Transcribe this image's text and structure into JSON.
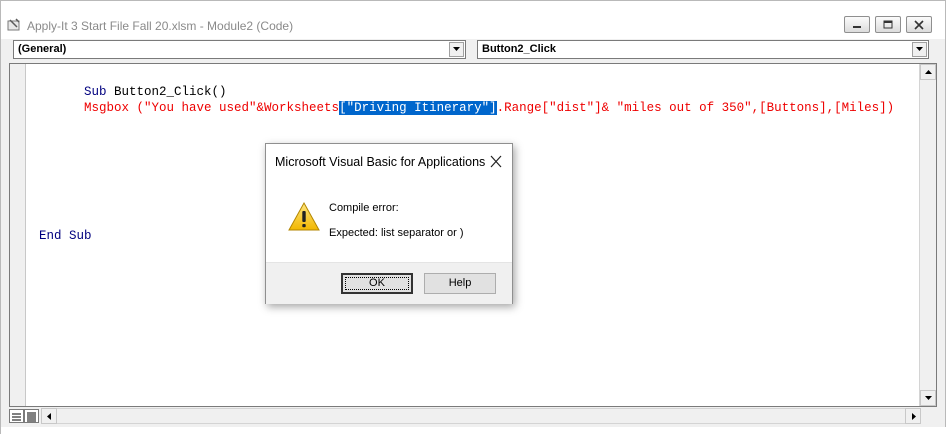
{
  "window": {
    "title": "Apply-It 3 Start File Fall 20.xlsm - Module2 (Code)"
  },
  "toolbar": {
    "object_combo": "(General)",
    "procedure_combo": "Button2_Click"
  },
  "code": {
    "line1_kw": "Sub",
    "line1_rest": " Button2_Click()",
    "line2_pre": "Msgbox (\"You have used\"&Worksheets",
    "line2_sel": "[\"Driving Itinerary\"]",
    "line2_post": ".Range[\"dist\"]& \"miles out of 350\",[Buttons],[Miles])",
    "line3": "End Sub"
  },
  "dialog": {
    "title": "Microsoft Visual Basic for Applications",
    "message_heading": "Compile error:",
    "message_detail": "Expected: list separator or )",
    "ok_label": "OK",
    "help_label": "Help",
    "icon": "warning-icon"
  },
  "colors": {
    "keyword": "#00007f",
    "error_line": "#ee0000",
    "selection": "#0066cc"
  }
}
